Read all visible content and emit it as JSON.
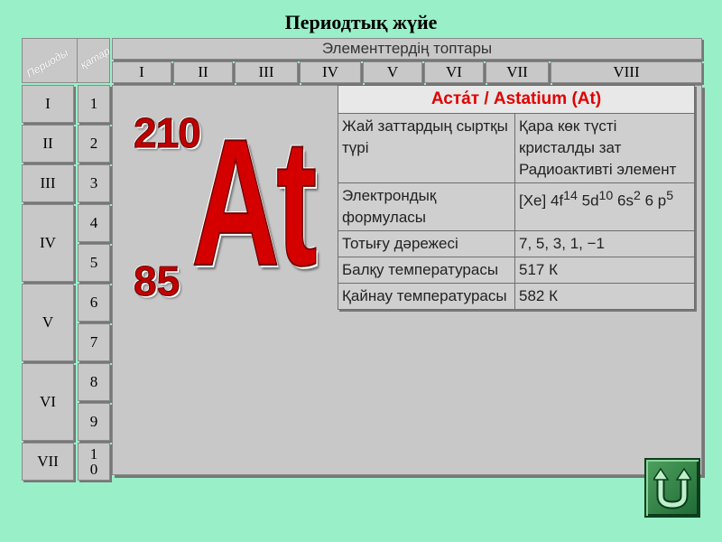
{
  "title": "Периодтық жүйе",
  "corner": {
    "periods_label": "Периоды",
    "rows_label": "қатары"
  },
  "groups_header": "Элементтердің топтары",
  "groups": [
    "I",
    "II",
    "III",
    "IV",
    "V",
    "VI",
    "VII",
    "VIII"
  ],
  "periods": [
    "I",
    "II",
    "III",
    "IV",
    "V",
    "VI",
    "VII"
  ],
  "rows": [
    "1",
    "2",
    "3",
    "4",
    "5",
    "6",
    "7",
    "8",
    "9",
    "10"
  ],
  "element": {
    "mass": "210",
    "number": "85",
    "symbol": "At"
  },
  "info": {
    "title": "Аста́т / Astatium (At)",
    "r1": {
      "key": "Жай заттардың сыртқы түрі",
      "value": "Қара көк түсті кристалды зат Радиоактивті элемент"
    },
    "r2": {
      "key": "Электрондық формуласы",
      "value_prefix": "[Xe] 4f",
      "sup1": "14",
      "mid1": " 5d",
      "sup2": "10",
      "mid2": " 6s",
      "sup3": "2",
      "mid3": " 6 p",
      "sup4": "5"
    },
    "r3": {
      "key": "Тотығу дәрежесі",
      "value": "7, 5, 3, 1, −1"
    },
    "r4": {
      "key": "Балқу температурасы",
      "value": "517 К"
    },
    "r5": {
      "key": "Қайнау температурасы",
      "value": "582 К"
    }
  },
  "colors": {
    "background": "#99f0c8",
    "panel": "#c8c8c8",
    "accent": "#d40000",
    "nav": "#2e7d42"
  },
  "nav": {
    "icon": "u-turn-back-icon"
  }
}
